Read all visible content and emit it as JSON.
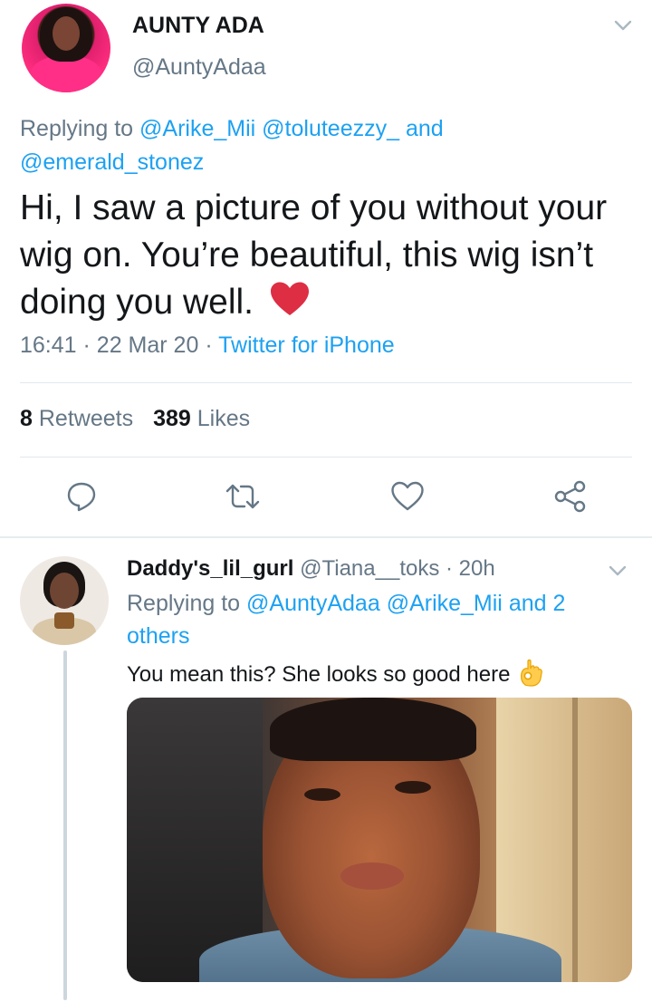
{
  "main_tweet": {
    "display_name": "AUNTY ADA",
    "handle": "@AuntyAdaa",
    "replying_prefix": "Replying to",
    "replying_mention_1": "@Arike_Mii",
    "replying_mention_2": "@toluteezzy_",
    "replying_and": "and",
    "replying_mention_3": "@emerald_stonez",
    "text": "Hi, I saw a picture of you without your wig on. You’re beautiful, this wig isn’t doing you well.",
    "emoji": "red-heart-emoji",
    "time": "16:41",
    "date": "22 Mar 20",
    "source": "Twitter for iPhone",
    "retweets_count": "8",
    "retweets_label": "Retweets",
    "likes_count": "389",
    "likes_label": "Likes"
  },
  "reply_tweet": {
    "display_name": "Daddy's_lil_gurl",
    "handle": "@Tiana__toks",
    "time": "20h",
    "replying_prefix": "Replying to",
    "replying_mention_1": "@AuntyAdaa",
    "replying_mention_2": "@Arike_Mii",
    "replying_suffix": "and 2 others",
    "text": "You mean this? She looks so good here",
    "emoji": "ok-hand-emoji"
  },
  "colors": {
    "link": "#1da1f2",
    "secondary_text": "#657786",
    "primary_text": "#14171a",
    "divider": "#e1e8ed",
    "icon": "#657786"
  },
  "icons": [
    "chevron-down-icon",
    "reply-icon",
    "retweet-icon",
    "like-icon",
    "share-icon"
  ]
}
